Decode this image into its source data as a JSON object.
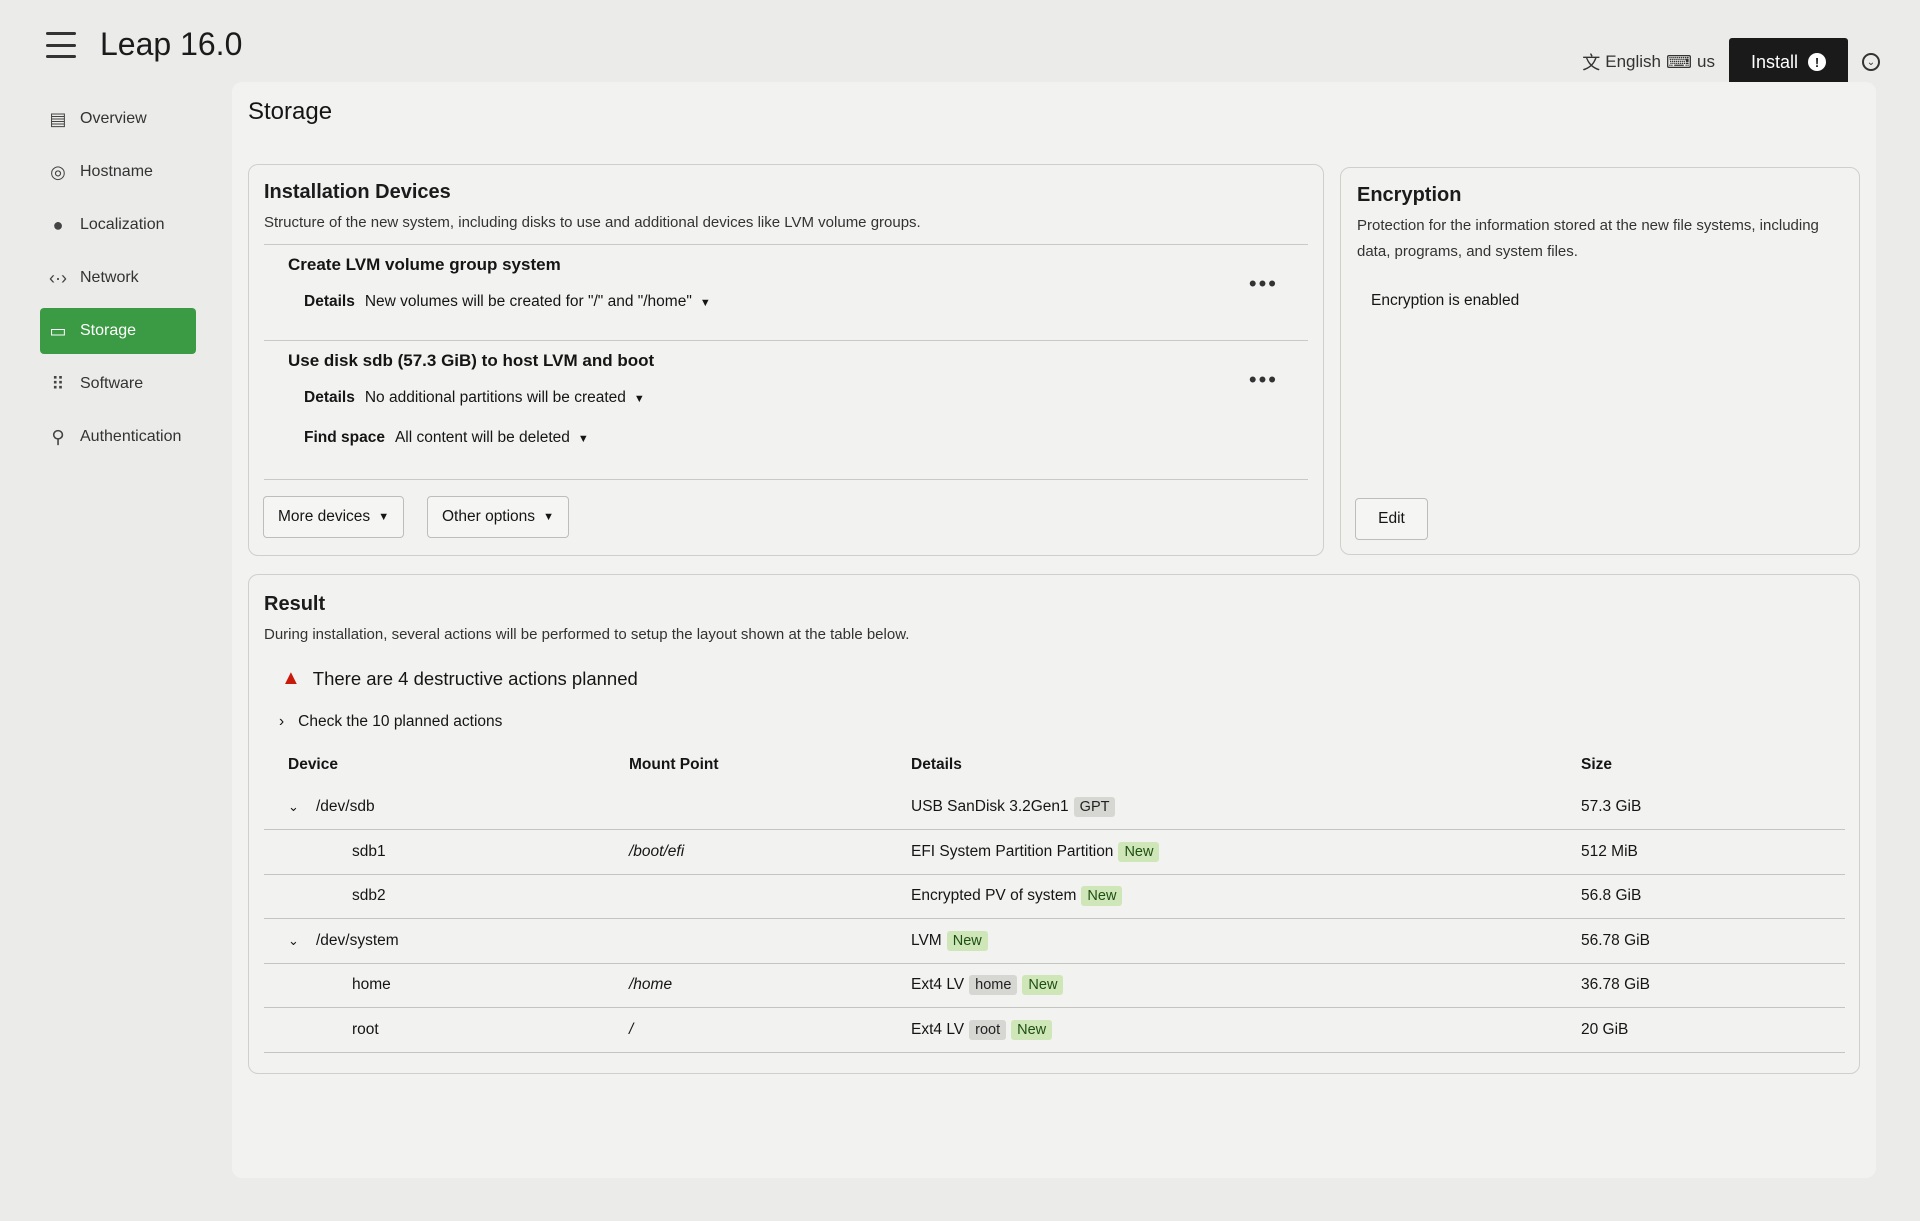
{
  "app": {
    "title": "Leap 16.0",
    "language": "English",
    "keyboard": "us",
    "install_label": "Install"
  },
  "sidebar": {
    "items": [
      {
        "label": "Overview",
        "icon": "overview-icon"
      },
      {
        "label": "Hostname",
        "icon": "fingerprint-icon"
      },
      {
        "label": "Localization",
        "icon": "globe-icon"
      },
      {
        "label": "Network",
        "icon": "network-icon"
      },
      {
        "label": "Storage",
        "icon": "storage-icon",
        "active": true
      },
      {
        "label": "Software",
        "icon": "grid-icon"
      },
      {
        "label": "Authentication",
        "icon": "user-key-icon"
      }
    ]
  },
  "page": {
    "title": "Storage"
  },
  "installation": {
    "title": "Installation Devices",
    "description": "Structure of the new system, including disks to use and additional devices like LVM volume groups.",
    "steps": [
      {
        "title": "Create LVM volume group system",
        "details_label": "Details",
        "details_value": "New volumes will be created for \"/\" and \"/home\""
      },
      {
        "title": "Use disk sdb (57.3 GiB) to host LVM and boot",
        "details_label": "Details",
        "details_value": "No additional partitions will be created",
        "find_space_label": "Find space",
        "find_space_value": "All content will be deleted"
      }
    ],
    "more_devices_label": "More devices",
    "other_options_label": "Other options"
  },
  "encryption": {
    "title": "Encryption",
    "description": "Protection for the information stored at the new file systems, including data, programs, and system files.",
    "status": "Encryption is enabled",
    "edit_label": "Edit"
  },
  "result": {
    "title": "Result",
    "description": "During installation, several actions will be performed to setup the layout shown at the table below.",
    "warning": "There are 4 destructive actions planned",
    "check_actions": "Check the 10 planned actions",
    "columns": [
      "Device",
      "Mount Point",
      "Details",
      "Size"
    ],
    "rows": [
      {
        "device": "/dev/sdb",
        "parent": true,
        "mount": "",
        "details": "USB SanDisk 3.2Gen1",
        "tags": [
          {
            "text": "GPT",
            "color": "gray"
          }
        ],
        "size": "57.3 GiB"
      },
      {
        "device": "sdb1",
        "parent": false,
        "mount": "/boot/efi",
        "details": "EFI System Partition Partition",
        "tags": [
          {
            "text": "New",
            "color": "green"
          }
        ],
        "size": "512 MiB"
      },
      {
        "device": "sdb2",
        "parent": false,
        "mount": "",
        "details": "Encrypted PV of system",
        "tags": [
          {
            "text": "New",
            "color": "green"
          }
        ],
        "size": "56.8 GiB"
      },
      {
        "device": "/dev/system",
        "parent": true,
        "mount": "",
        "details": "LVM",
        "tags": [
          {
            "text": "New",
            "color": "green"
          }
        ],
        "size": "56.78 GiB"
      },
      {
        "device": "home",
        "parent": false,
        "mount": "/home",
        "details": "Ext4 LV",
        "tags": [
          {
            "text": "home",
            "color": "gray"
          },
          {
            "text": "New",
            "color": "green"
          }
        ],
        "size": "36.78 GiB"
      },
      {
        "device": "root",
        "parent": false,
        "mount": "/",
        "details": "Ext4 LV",
        "tags": [
          {
            "text": "root",
            "color": "gray"
          },
          {
            "text": "New",
            "color": "green"
          }
        ],
        "size": "20 GiB"
      }
    ]
  },
  "colors": {
    "active_nav": "#3b9a44",
    "new_tag_bg": "#cfe7b8",
    "gray_tag_bg": "#d6d6d3",
    "warning": "#c9190b"
  }
}
